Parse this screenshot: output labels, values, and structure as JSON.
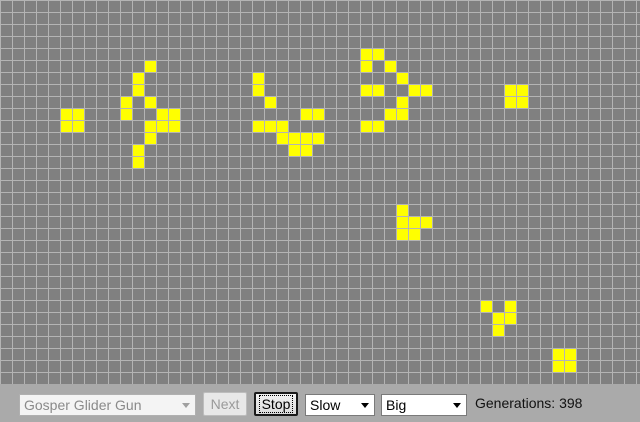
{
  "game": {
    "grid_color": "#b4b4b4",
    "dead_color": "#808080",
    "live_color": "#ffff00",
    "live_cells": [
      [
        5,
        9
      ],
      [
        6,
        9
      ],
      [
        5,
        10
      ],
      [
        6,
        10
      ],
      [
        11,
        6
      ],
      [
        11,
        7
      ],
      [
        12,
        8
      ],
      [
        13,
        9
      ],
      [
        14,
        9
      ],
      [
        13,
        10
      ],
      [
        14,
        10
      ],
      [
        12,
        11
      ],
      [
        11,
        12
      ],
      [
        11,
        13
      ],
      [
        10,
        9
      ],
      [
        10,
        8
      ],
      [
        12,
        5
      ],
      [
        12,
        10
      ],
      [
        21,
        6
      ],
      [
        21,
        7
      ],
      [
        22,
        8
      ],
      [
        21,
        10
      ],
      [
        22,
        10
      ],
      [
        23,
        10
      ],
      [
        24,
        11
      ],
      [
        25,
        11
      ],
      [
        23,
        11
      ],
      [
        24,
        12
      ],
      [
        25,
        12
      ],
      [
        26,
        11
      ],
      [
        26,
        9
      ],
      [
        25,
        9
      ],
      [
        30,
        4
      ],
      [
        30,
        5
      ],
      [
        31,
        4
      ],
      [
        32,
        5
      ],
      [
        33,
        6
      ],
      [
        30,
        7
      ],
      [
        31,
        7
      ],
      [
        34,
        7
      ],
      [
        35,
        7
      ],
      [
        33,
        8
      ],
      [
        32,
        9
      ],
      [
        33,
        9
      ],
      [
        30,
        10
      ],
      [
        31,
        10
      ],
      [
        42,
        7
      ],
      [
        43,
        7
      ],
      [
        42,
        8
      ],
      [
        43,
        8
      ],
      [
        33,
        17
      ],
      [
        34,
        18
      ],
      [
        35,
        18
      ],
      [
        33,
        19
      ],
      [
        34,
        19
      ],
      [
        33,
        18
      ],
      [
        40,
        25
      ],
      [
        41,
        26
      ],
      [
        42,
        26
      ],
      [
        42,
        25
      ],
      [
        41,
        27
      ],
      [
        46,
        29
      ],
      [
        47,
        29
      ],
      [
        46,
        30
      ],
      [
        47,
        30
      ]
    ]
  },
  "controls": {
    "pattern_select": {
      "value": "Gosper Glider Gun"
    },
    "next_button": {
      "label": "Next"
    },
    "stop_button": {
      "label": "Stop"
    },
    "speed_select": {
      "value": "Slow"
    },
    "size_select": {
      "value": "Big"
    },
    "generations": {
      "label": "Generations:",
      "value": "398"
    }
  }
}
